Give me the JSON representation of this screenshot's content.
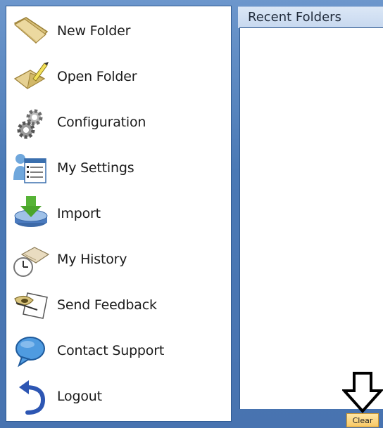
{
  "menu": {
    "items": [
      {
        "label": "New Folder",
        "icon": "new-folder-icon"
      },
      {
        "label": "Open Folder",
        "icon": "open-folder-icon"
      },
      {
        "label": "Configuration",
        "icon": "gears-icon"
      },
      {
        "label": "My Settings",
        "icon": "user-settings-icon"
      },
      {
        "label": "Import",
        "icon": "import-icon"
      },
      {
        "label": "My History",
        "icon": "history-icon"
      },
      {
        "label": "Send Feedback",
        "icon": "feedback-icon"
      },
      {
        "label": "Contact Support",
        "icon": "speech-bubble-icon"
      },
      {
        "label": "Logout",
        "icon": "logout-arrow-icon"
      }
    ]
  },
  "recent": {
    "title": "Recent Folders",
    "clear_label": "Clear"
  },
  "colors": {
    "frame_blue": "#4a79b5",
    "clear_button": "#f8c865"
  }
}
